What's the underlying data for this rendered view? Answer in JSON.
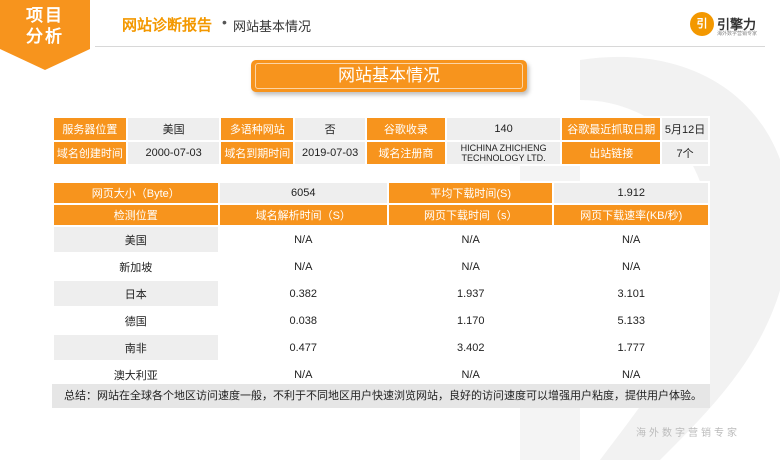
{
  "corner": {
    "line1": "项目",
    "line2": "分析"
  },
  "header": {
    "title": "网站诊断报告",
    "dot": "•",
    "subtitle": "网站基本情况"
  },
  "logo": {
    "mark": "引",
    "name": "引擎力",
    "tagline": "海外数字营销专家"
  },
  "banner": "网站基本情况",
  "basic_info": [
    [
      "服务器位置",
      "美国",
      "多语种网站",
      "否",
      "谷歌收录",
      "140",
      "谷歌最近抓取日期",
      "5月12日"
    ],
    [
      "域名创建时间",
      "2000-07-03",
      "域名到期时间",
      "2019-07-03",
      "域名注册商",
      "HICHINA ZHICHENG TECHNOLOGY LTD.",
      "出站链接",
      "7个"
    ]
  ],
  "speed": {
    "page_size_label": "网页大小（Byte）",
    "page_size_value": "6054",
    "avg_time_label": "平均下载时间(S)",
    "avg_time_value": "1.912",
    "headers": [
      "检测位置",
      "域名解析时间（S）",
      "网页下载时间（s）",
      "网页下载速率(KB/秒)"
    ],
    "rows": [
      [
        "美国",
        "N/A",
        "N/A",
        "N/A"
      ],
      [
        "新加坡",
        "N/A",
        "N/A",
        "N/A"
      ],
      [
        "日本",
        "0.382",
        "1.937",
        "3.101"
      ],
      [
        "德国",
        "0.038",
        "1.170",
        "5.133"
      ],
      [
        "南非",
        "0.477",
        "3.402",
        "1.777"
      ],
      [
        "澳大利亚",
        "N/A",
        "N/A",
        "N/A"
      ]
    ]
  },
  "summary": "总结：网站在全球各个地区访问速度一般，不利于不同地区用户快速浏览网站，良好的访问速度可以增强用户粘度，提供用户体验。",
  "footer": "海外数字营销专家",
  "colors": {
    "accent": "#f7941d",
    "gray": "#eeeeee"
  }
}
